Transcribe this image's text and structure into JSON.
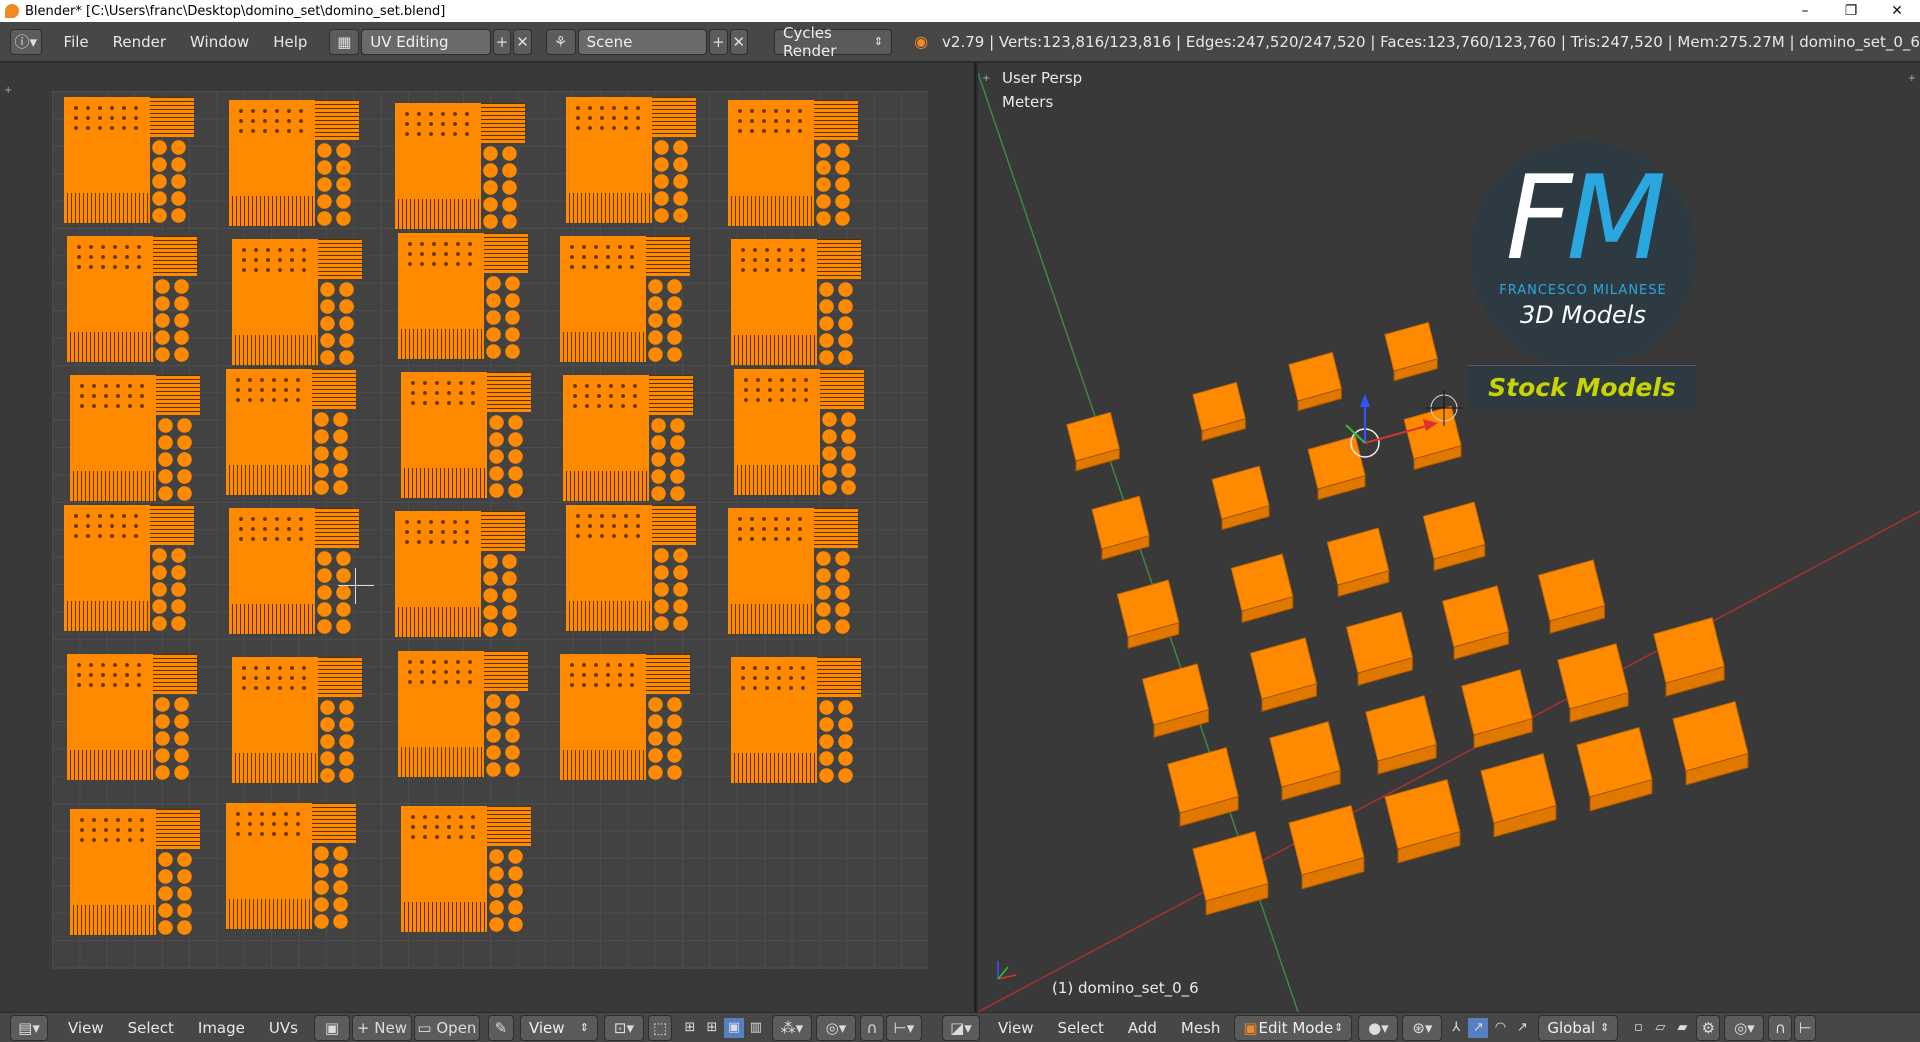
{
  "window": {
    "title": "Blender* [C:\\Users\\franc\\Desktop\\domino_set\\domino_set.blend]",
    "controls": [
      "–",
      "❐",
      "✕"
    ]
  },
  "menubar": {
    "menus": [
      "File",
      "Render",
      "Window",
      "Help"
    ],
    "layout_field": "UV Editing",
    "scene_field": "Scene",
    "render_engine": "Cycles Render",
    "stats": "v2.79 | Verts:123,816/123,816 | Edges:247,520/247,520 | Faces:123,760/123,760 | Tris:247,520 | Mem:275.27M | domino_set_0_6"
  },
  "viewport": {
    "view_label": "User Persp",
    "units_label": "Meters",
    "object_label": "(1) domino_set_0_6",
    "logo": {
      "letters": "FM",
      "name": "FRANCESCO MILANESE",
      "tagline": "3D Models",
      "banner": "Stock Models"
    }
  },
  "uv_footer": {
    "items": [
      "View",
      "Select",
      "Image",
      "UVs"
    ],
    "new_label": "New",
    "open_label": "Open",
    "view_label": "View"
  },
  "view3d_footer": {
    "items": [
      "View",
      "Select",
      "Add",
      "Mesh"
    ],
    "mode": "Edit Mode",
    "orientation": "Global"
  },
  "colors": {
    "domino_orange": "#ff8a00",
    "logo_blue": "#29a8e0",
    "banner_yellow": "#c8d400"
  }
}
